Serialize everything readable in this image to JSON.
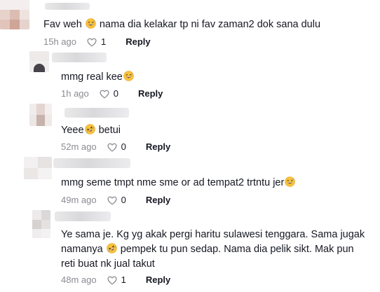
{
  "colors": {
    "text": "#161823",
    "meta": "#8a8b91",
    "emoji_face": "#f9c23c"
  },
  "icons": {
    "like": "heart-outline-icon",
    "emoji_grin": "grinning-sweat-emoji",
    "emoji_rofl": "rolling-laughing-emoji"
  },
  "comments": [
    {
      "text_parts": [
        "Fav weh ",
        " nama dia kelakar tp ni fav zaman2 dok sana dulu"
      ],
      "emojis": [
        "grinning-sweat-emoji"
      ],
      "time": "15h ago",
      "likes": "1",
      "reply_label": "Reply"
    },
    {
      "text_parts": [
        "mmg real kee",
        ""
      ],
      "emojis": [
        "grinning-sweat-emoji"
      ],
      "time": "1h ago",
      "likes": "0",
      "reply_label": "Reply"
    },
    {
      "text_parts": [
        "Yeee",
        " betui"
      ],
      "emojis": [
        "rolling-laughing-emoji"
      ],
      "time": "52m ago",
      "likes": "0",
      "reply_label": "Reply"
    },
    {
      "text_parts": [
        "mmg seme tmpt nme sme or ad tempat2 trtntu jer",
        ""
      ],
      "emojis": [
        "grinning-sweat-emoji"
      ],
      "time": "49m ago",
      "likes": "0",
      "reply_label": "Reply"
    },
    {
      "line1": "Ye sama je. Kg yg akak pergi haritu sulawesi tenggara. Sama jugak",
      "line2_parts": [
        "namanya ",
        " pempek tu pun sedap. Nama dia pelik sikt. Mak pun"
      ],
      "line3": "reti buat nk jual takut",
      "emojis": [
        "rolling-laughing-emoji"
      ],
      "time": "48m ago",
      "likes": "1",
      "reply_label": "Reply"
    }
  ]
}
